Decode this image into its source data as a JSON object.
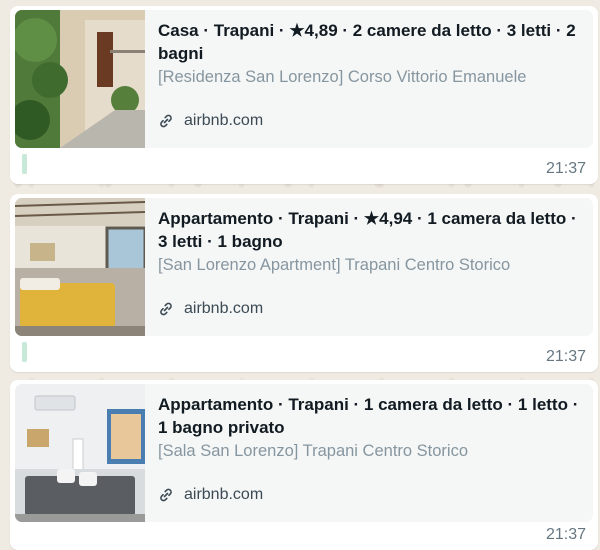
{
  "messages": [
    {
      "title": "Casa · Trapani · ★4,89 · 2 camere da letto · 3 letti · 2 bagni",
      "subtitle": "[Residenza San Lorenzo] Corso Vittorio Emanuele",
      "domain": "airbnb.com",
      "time": "21:37",
      "thumbnail_icon": "house-courtyard-photo"
    },
    {
      "title": "Appartamento · Trapani · ★4,94 · 1 camera da letto · 3 letti · 1 bagno",
      "subtitle": "[San Lorenzo Apartment] Trapani Centro Storico",
      "domain": "airbnb.com",
      "time": "21:37",
      "thumbnail_icon": "bedroom-photo"
    },
    {
      "title": "Appartamento · Trapani · 1 camera da letto · 1 letto · 1 bagno privato",
      "subtitle": "[Sala San Lorenzo] Trapani Centro Storico",
      "domain": "airbnb.com",
      "time": "21:37",
      "thumbnail_icon": "bedroom-photo"
    }
  ],
  "colors": {
    "chat_background": "#efeae2",
    "bubble": "#ffffff",
    "preview_card": "#f5f6f6",
    "title_text": "#111b21",
    "subtitle_text": "#8696a0",
    "timestamp_text": "#667781"
  }
}
